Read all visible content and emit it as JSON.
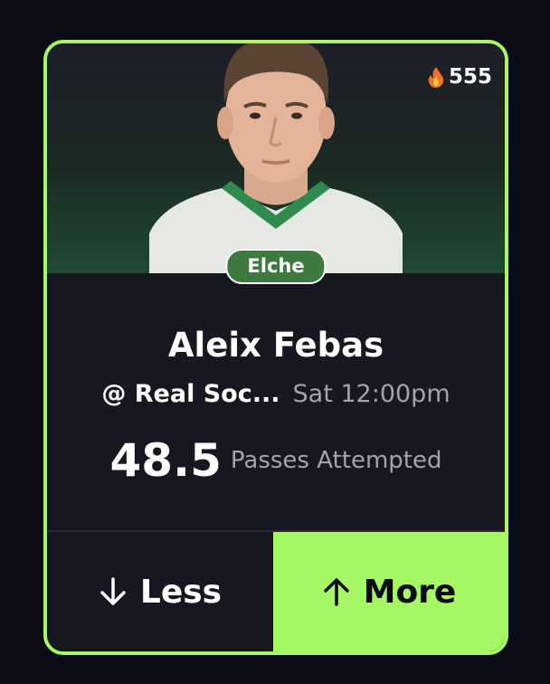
{
  "streak": {
    "icon": "flame-icon",
    "count": "555"
  },
  "player": {
    "team": "Elche",
    "name": "Aleix Febas",
    "opponent": "@ Real Soc...",
    "game_time": "Sat 12:00pm"
  },
  "projection": {
    "value": "48.5",
    "stat": "Passes Attempted"
  },
  "actions": {
    "less_label": "Less",
    "more_label": "More"
  },
  "colors": {
    "accent": "#a6f764",
    "card_bg": "#171722",
    "team_badge": "#3c7a3f"
  }
}
